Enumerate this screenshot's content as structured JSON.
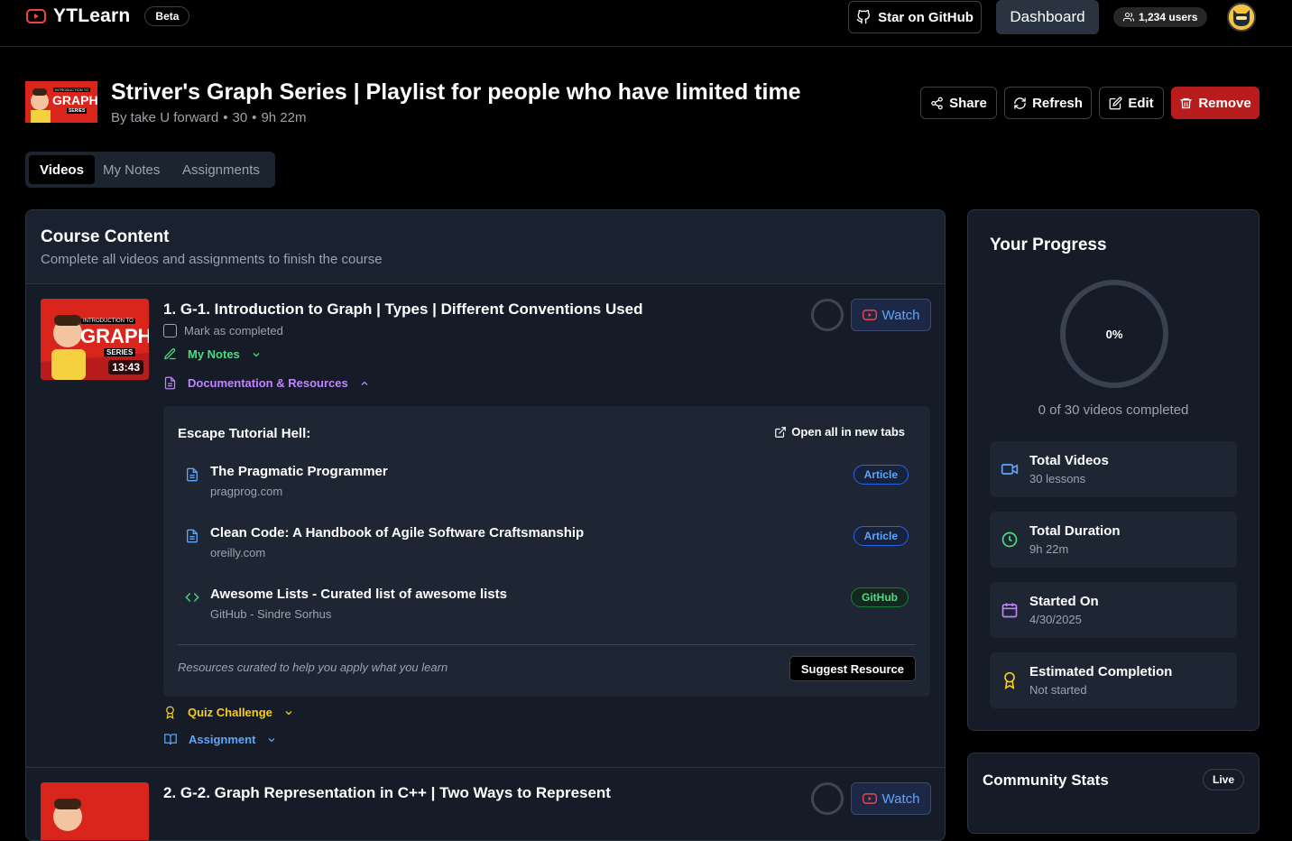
{
  "nav": {
    "brand": "YTLearn",
    "beta": "Beta",
    "github": "Star on GitHub",
    "dashboard": "Dashboard",
    "users": "1,234 users"
  },
  "playlist": {
    "title": "Striver's Graph Series | Playlist for people who have limited time",
    "author": "By take U forward",
    "sep": "•",
    "count": "30",
    "duration": "9h 22m",
    "thumb_text": "GRAPH",
    "thumb_sub": "SERIES",
    "thumb_tag": "INTRODUCTION TO"
  },
  "actions": {
    "share": "Share",
    "refresh": "Refresh",
    "edit": "Edit",
    "remove": "Remove"
  },
  "tabs": [
    "Videos",
    "My Notes",
    "Assignments"
  ],
  "course": {
    "title": "Course Content",
    "subtitle": "Complete all videos and assignments to finish the course"
  },
  "videos": [
    {
      "title": "1. G-1. Introduction to Graph | Types | Different Conventions Used",
      "duration": "13:43",
      "watch": "Watch",
      "mark": "Mark as completed",
      "notes": "My Notes",
      "docs": "Documentation & Resources",
      "quiz": "Quiz Challenge",
      "assignment": "Assignment"
    },
    {
      "title": "2. G-2. Graph Representation in C++ | Two Ways to Represent",
      "watch": "Watch"
    }
  ],
  "resources": {
    "heading": "Escape Tutorial Hell:",
    "open_all": "Open all in new tabs",
    "items": [
      {
        "name": "The Pragmatic Programmer",
        "source": "pragprog.com",
        "tag": "Article"
      },
      {
        "name": "Clean Code: A Handbook of Agile Software Craftsmanship",
        "source": "oreilly.com",
        "tag": "Article"
      },
      {
        "name": "Awesome Lists - Curated list of awesome lists",
        "source": "GitHub - Sindre Sorhus",
        "tag": "GitHub"
      }
    ],
    "footer": "Resources curated to help you apply what you learn",
    "suggest": "Suggest Resource"
  },
  "progress": {
    "title": "Your Progress",
    "percent": "0%",
    "summary": "0 of 30 videos completed",
    "stats": [
      {
        "label": "Total Videos",
        "value": "30 lessons",
        "icon": "video-icon",
        "color": "#60a5fa"
      },
      {
        "label": "Total Duration",
        "value": "9h 22m",
        "icon": "clock-icon",
        "color": "#4ade80"
      },
      {
        "label": "Started On",
        "value": "4/30/2025",
        "icon": "calendar-icon",
        "color": "#c084fc"
      },
      {
        "label": "Estimated Completion",
        "value": "Not started",
        "icon": "award-icon",
        "color": "#facc15"
      }
    ]
  },
  "community": {
    "title": "Community Stats",
    "live": "Live"
  },
  "colors": {
    "notes": "#4ade80",
    "docs": "#c084fc",
    "quiz": "#facc15",
    "assignment": "#60a5fa",
    "remove": "#b91c1c",
    "watch": "#60a5fa"
  }
}
